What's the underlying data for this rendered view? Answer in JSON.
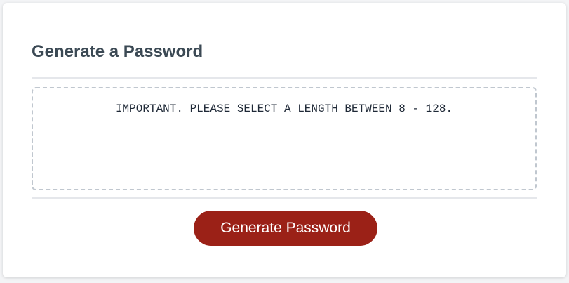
{
  "card": {
    "title": "Generate a Password"
  },
  "password_box": {
    "text": "IMPORTANT. PLEASE SELECT A LENGTH BETWEEN 8 - 128."
  },
  "actions": {
    "generate_label": "Generate Password"
  },
  "colors": {
    "accent": "#9b2117",
    "heading": "#3b4752",
    "border_dashed": "#c0c7cf",
    "divider": "#e5e7eb",
    "card_background": "#ffffff",
    "page_background": "#f3f4f6"
  }
}
